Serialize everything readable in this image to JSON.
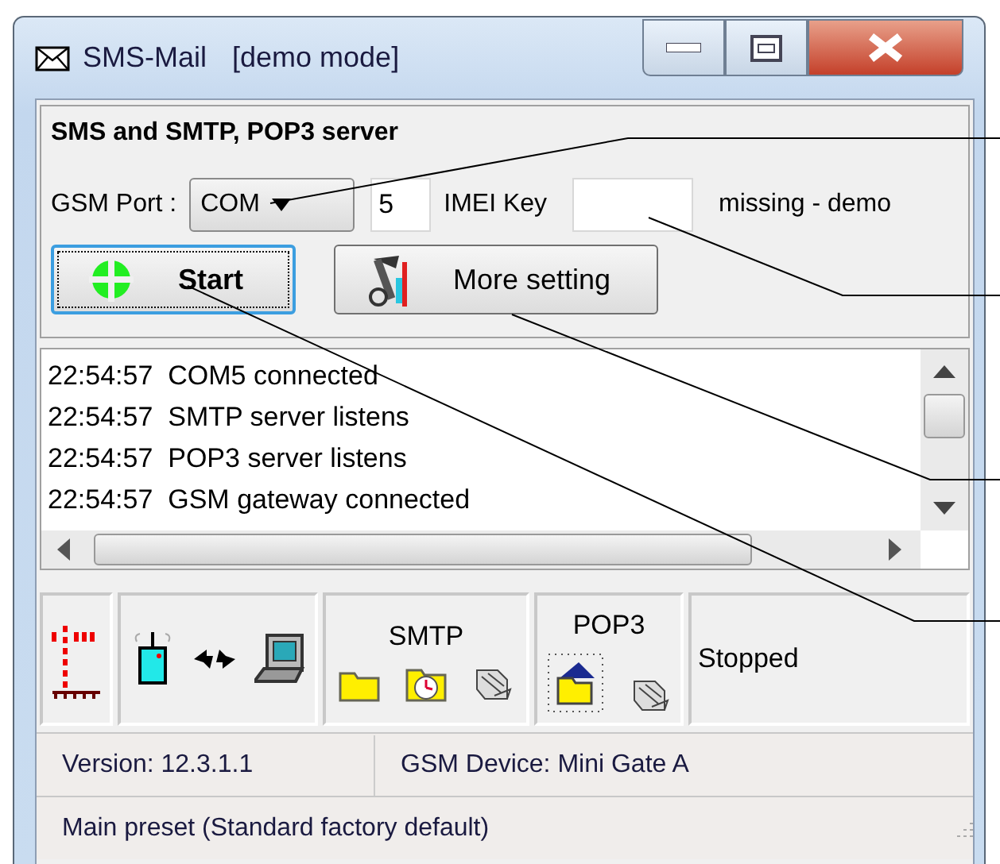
{
  "window": {
    "title": "SMS-Mail",
    "mode": "[demo mode]"
  },
  "group": {
    "title": "SMS and SMTP, POP3 server",
    "port_label": "GSM Port :",
    "port_select": "COM",
    "port_number": "5",
    "imei_label": "IMEI Key",
    "imei_status": "missing - demo"
  },
  "buttons": [
    {
      "kind": "start",
      "label": "Start",
      "focused": true
    },
    {
      "kind": "settings",
      "label": "More setting",
      "focused": false
    }
  ],
  "log": {
    "lines": [
      {
        "time": "22:54:57",
        "message": "COM5 connected"
      },
      {
        "time": "22:54:57",
        "message": "SMTP server listens"
      },
      {
        "time": "22:54:57",
        "message": "POP3 server listens"
      },
      {
        "time": "22:54:57",
        "message": "GSM gateway connected"
      }
    ]
  },
  "status_panel": {
    "smtp_label": "SMTP",
    "pop3_label": "POP3",
    "state": "Stopped"
  },
  "status_bar": {
    "version": "Version: 12.3.1.1",
    "device": "GSM Device: Mini Gate A",
    "preset": "Main preset (Standard factory default)"
  }
}
